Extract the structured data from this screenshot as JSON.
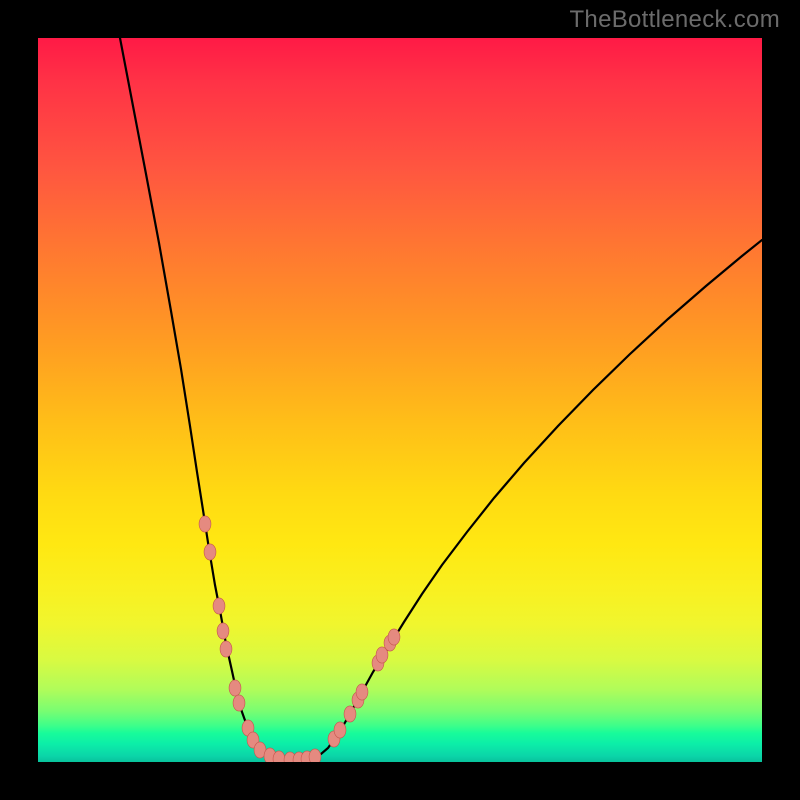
{
  "watermark": "TheBottleneck.com",
  "colors": {
    "frame": "#000000",
    "curve_stroke": "#000000",
    "marker_fill": "#e58a80",
    "marker_stroke": "#c5554c",
    "gradient_stops": [
      {
        "pct": 0,
        "hex": "#ff1a46"
      },
      {
        "pct": 6,
        "hex": "#ff3246"
      },
      {
        "pct": 18,
        "hex": "#ff5640"
      },
      {
        "pct": 30,
        "hex": "#ff7a30"
      },
      {
        "pct": 42,
        "hex": "#ff9c22"
      },
      {
        "pct": 53,
        "hex": "#ffbe18"
      },
      {
        "pct": 63,
        "hex": "#ffda12"
      },
      {
        "pct": 70,
        "hex": "#ffe812"
      },
      {
        "pct": 76,
        "hex": "#f9f020"
      },
      {
        "pct": 81,
        "hex": "#f0f62e"
      },
      {
        "pct": 86,
        "hex": "#d8fa42"
      },
      {
        "pct": 90,
        "hex": "#b0fc5a"
      },
      {
        "pct": 93,
        "hex": "#78fd72"
      },
      {
        "pct": 95,
        "hex": "#3dfe8a"
      },
      {
        "pct": 96,
        "hex": "#18fc9a"
      },
      {
        "pct": 97.5,
        "hex": "#0ceea8"
      },
      {
        "pct": 99.2,
        "hex": "#0bd4a8"
      },
      {
        "pct": 100,
        "hex": "#08c29c"
      }
    ]
  },
  "chart_data": {
    "type": "line",
    "title": "",
    "xlabel": "",
    "ylabel": "",
    "xlim": [
      0,
      1000
    ],
    "ylim": [
      0,
      1000
    ],
    "left_curve": {
      "name": "left-branch",
      "points_svg": [
        [
          82,
          0
        ],
        [
          95,
          68
        ],
        [
          108,
          136
        ],
        [
          121,
          205
        ],
        [
          133,
          273
        ],
        [
          143,
          331
        ],
        [
          152,
          388
        ],
        [
          159,
          434
        ],
        [
          165,
          472
        ],
        [
          171,
          511
        ],
        [
          177,
          547
        ],
        [
          183,
          578
        ],
        [
          188,
          606
        ],
        [
          194,
          633
        ],
        [
          199,
          656
        ],
        [
          204,
          674
        ],
        [
          209,
          688
        ],
        [
          214,
          700
        ],
        [
          219,
          708
        ],
        [
          225,
          714
        ],
        [
          231,
          717
        ],
        [
          237,
          719
        ],
        [
          247,
          721
        ],
        [
          257,
          722
        ],
        [
          268,
          722
        ]
      ]
    },
    "right_curve": {
      "name": "right-branch",
      "points_svg": [
        [
          268,
          722
        ],
        [
          276,
          720
        ],
        [
          283,
          716
        ],
        [
          290,
          710
        ],
        [
          297,
          700
        ],
        [
          305,
          688
        ],
        [
          314,
          672
        ],
        [
          324,
          654
        ],
        [
          335,
          634
        ],
        [
          350,
          610
        ],
        [
          366,
          584
        ],
        [
          384,
          556
        ],
        [
          404,
          527
        ],
        [
          429,
          494
        ],
        [
          456,
          460
        ],
        [
          486,
          425
        ],
        [
          520,
          388
        ],
        [
          555,
          352
        ],
        [
          592,
          316
        ],
        [
          630,
          281
        ],
        [
          668,
          248
        ],
        [
          704,
          218
        ],
        [
          724,
          202
        ]
      ]
    },
    "markers": {
      "name": "cluster-points",
      "radius": 7,
      "points_svg": [
        [
          167,
          486
        ],
        [
          172,
          514
        ],
        [
          181,
          568
        ],
        [
          185,
          593
        ],
        [
          188,
          611
        ],
        [
          197,
          650
        ],
        [
          201,
          665
        ],
        [
          210,
          690
        ],
        [
          215,
          702
        ],
        [
          222,
          712
        ],
        [
          232,
          718
        ],
        [
          241,
          721
        ],
        [
          252,
          722
        ],
        [
          261,
          722
        ],
        [
          269,
          721
        ],
        [
          277,
          719
        ],
        [
          296,
          701
        ],
        [
          302,
          692
        ],
        [
          312,
          676
        ],
        [
          320,
          662
        ],
        [
          324,
          654
        ],
        [
          340,
          625
        ],
        [
          344,
          617
        ],
        [
          352,
          605
        ],
        [
          356,
          599
        ]
      ]
    }
  }
}
